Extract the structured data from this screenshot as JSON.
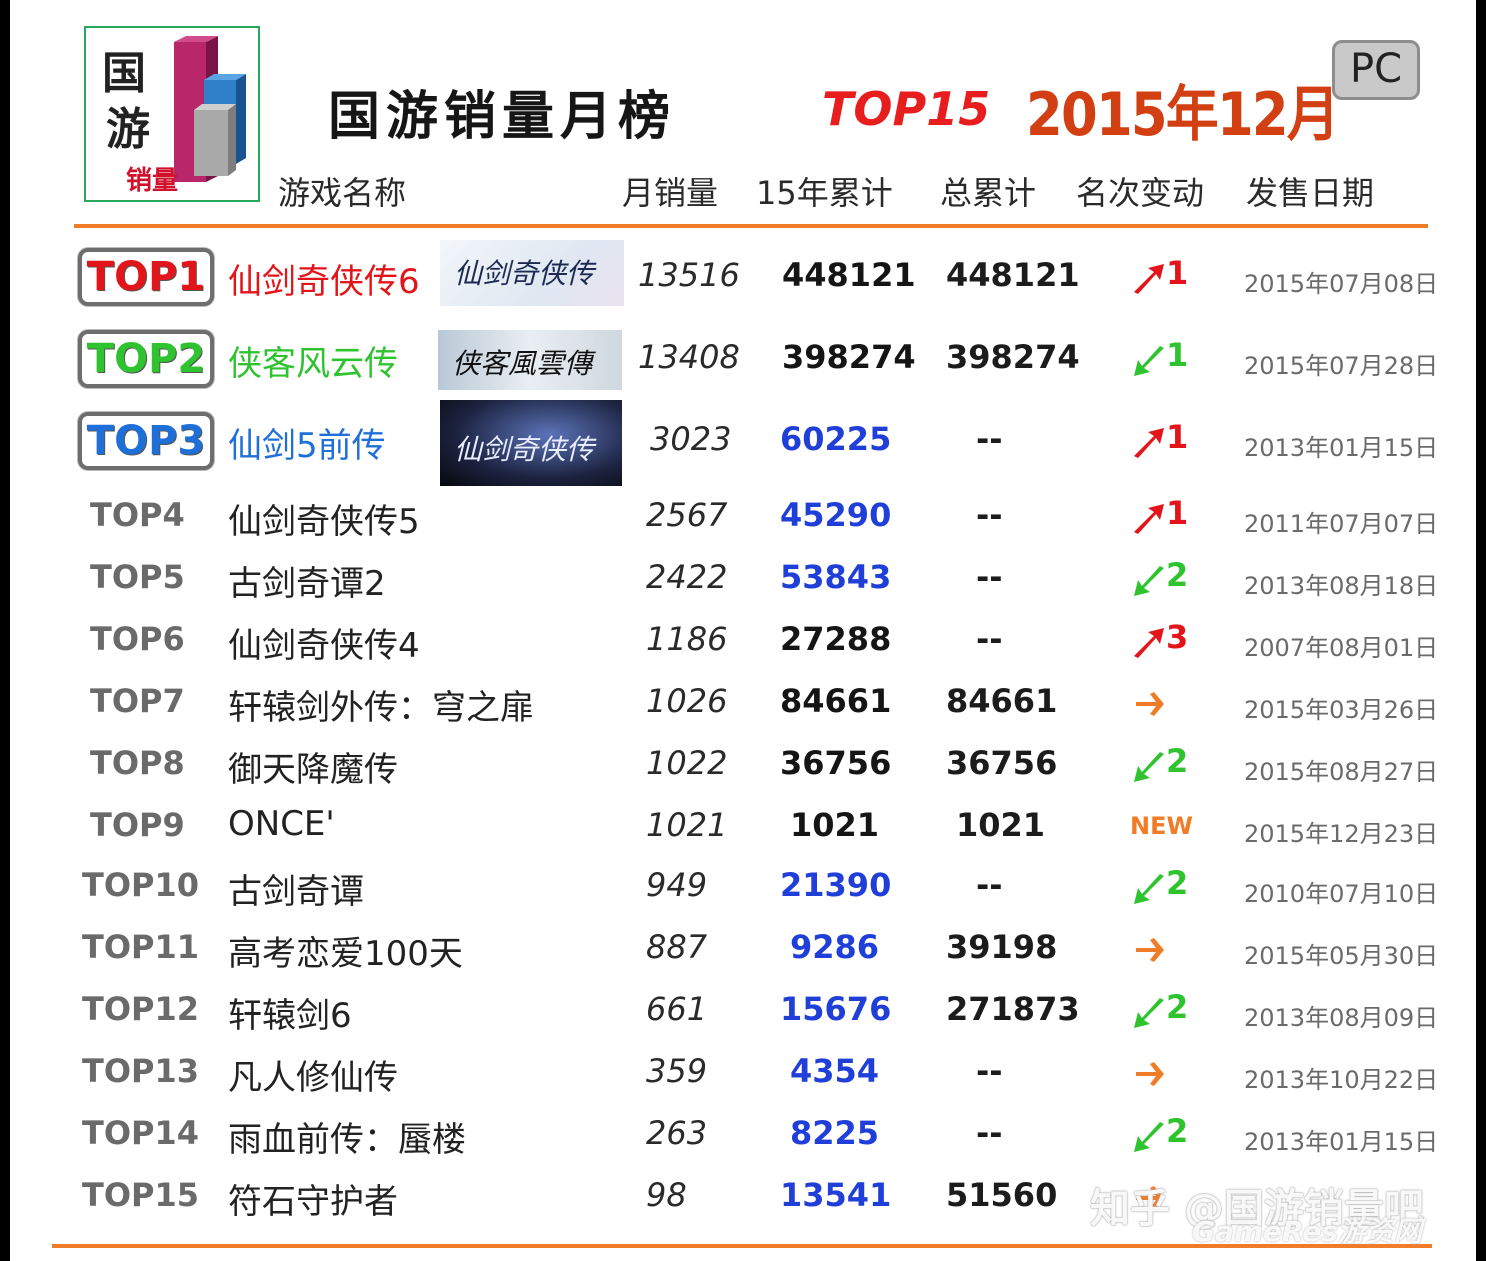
{
  "logo": {
    "chars": [
      "国",
      "游"
    ],
    "sub": "销量"
  },
  "title": {
    "main": "国游销量月榜",
    "top": "TOP15",
    "period": "2015年12月",
    "platform": "PC"
  },
  "headers": {
    "name": "游戏名称",
    "monthly": "月销量",
    "year": "15年累计",
    "total": "总累计",
    "change": "名次变动",
    "date": "发售日期"
  },
  "colors": {
    "accent_orange": "#f07c28",
    "up": "#e3151a",
    "down": "#2fc42f",
    "same": "#f07c28",
    "blue_value": "#1f3fd8"
  },
  "rows": [
    {
      "rank": "TOP1",
      "name": "仙剑奇侠传6",
      "monthly": "13516",
      "year": "448121",
      "total": "448121",
      "change_dir": "up",
      "change_num": "1",
      "date": "2015年07月08日",
      "thumb": "仙剑奇侠传"
    },
    {
      "rank": "TOP2",
      "name": "侠客风云传",
      "monthly": "13408",
      "year": "398274",
      "total": "398274",
      "change_dir": "down",
      "change_num": "1",
      "date": "2015年07月28日",
      "thumb": "侠客風雲傳"
    },
    {
      "rank": "TOP3",
      "name": "仙剑5前传",
      "monthly": "3023",
      "year": "60225",
      "total": "--",
      "change_dir": "up",
      "change_num": "1",
      "date": "2013年01月15日",
      "thumb": "仙剑奇侠传"
    },
    {
      "rank": "TOP4",
      "name": "仙剑奇侠传5",
      "monthly": "2567",
      "year": "45290",
      "total": "--",
      "change_dir": "up",
      "change_num": "1",
      "date": "2011年07月07日"
    },
    {
      "rank": "TOP5",
      "name": "古剑奇谭2",
      "monthly": "2422",
      "year": "53843",
      "total": "--",
      "change_dir": "down",
      "change_num": "2",
      "date": "2013年08月18日"
    },
    {
      "rank": "TOP6",
      "name": "仙剑奇侠传4",
      "monthly": "1186",
      "year": "27288",
      "total": "--",
      "change_dir": "up",
      "change_num": "3",
      "date": "2007年08月01日"
    },
    {
      "rank": "TOP7",
      "name": "轩辕剑外传：穹之扉",
      "monthly": "1026",
      "year": "84661",
      "total": "84661",
      "change_dir": "same",
      "change_num": "",
      "date": "2015年03月26日"
    },
    {
      "rank": "TOP8",
      "name": "御天降魔传",
      "monthly": "1022",
      "year": "36756",
      "total": "36756",
      "change_dir": "down",
      "change_num": "2",
      "date": "2015年08月27日"
    },
    {
      "rank": "TOP9",
      "name": "ONCE'",
      "monthly": "1021",
      "year": "1021",
      "total": "1021",
      "change_dir": "new",
      "change_num": "NEW",
      "date": "2015年12月23日"
    },
    {
      "rank": "TOP10",
      "name": "古剑奇谭",
      "monthly": "949",
      "year": "21390",
      "total": "--",
      "change_dir": "down",
      "change_num": "2",
      "date": "2010年07月10日"
    },
    {
      "rank": "TOP11",
      "name": "高考恋爱100天",
      "monthly": "887",
      "year": "9286",
      "total": "39198",
      "change_dir": "same",
      "change_num": "",
      "date": "2015年05月30日"
    },
    {
      "rank": "TOP12",
      "name": "轩辕剑6",
      "monthly": "661",
      "year": "15676",
      "total": "271873",
      "change_dir": "down",
      "change_num": "2",
      "date": "2013年08月09日"
    },
    {
      "rank": "TOP13",
      "name": "凡人修仙传",
      "monthly": "359",
      "year": "4354",
      "total": "--",
      "change_dir": "same",
      "change_num": "",
      "date": "2013年10月22日"
    },
    {
      "rank": "TOP14",
      "name": "雨血前传：蜃楼",
      "monthly": "263",
      "year": "8225",
      "total": "--",
      "change_dir": "down",
      "change_num": "2",
      "date": "2013年01月15日"
    },
    {
      "rank": "TOP15",
      "name": "符石守护者",
      "monthly": "98",
      "year": "13541",
      "total": "51560",
      "change_dir": "same",
      "change_num": "",
      "date": ""
    }
  ],
  "watermark": {
    "line1": "知乎 @国游销量吧",
    "line2": "GameRes游资网"
  }
}
